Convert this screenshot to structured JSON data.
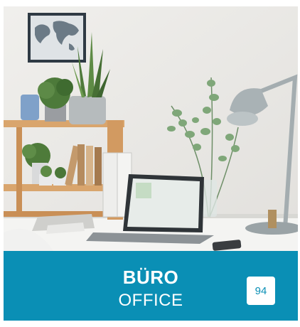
{
  "tile": {
    "title_de": "BÜRO",
    "title_en": "OFFICE",
    "page_number": "94"
  },
  "colors": {
    "accent": "#0a8fb5",
    "text_on_accent": "#ffffff"
  },
  "image": {
    "icon": "office-desk-photo"
  }
}
